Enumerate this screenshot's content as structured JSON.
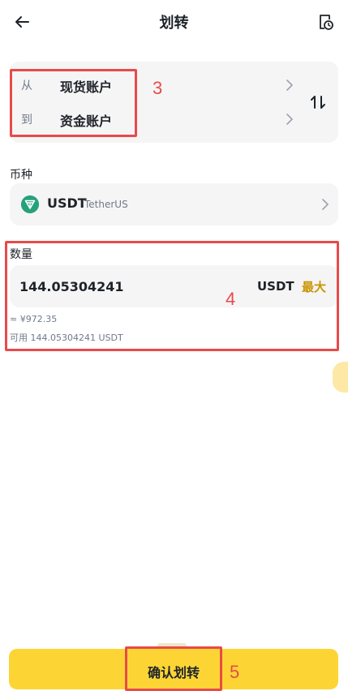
{
  "header": {
    "title": "划转"
  },
  "transfer": {
    "from_label": "从",
    "from_account": "现货账户",
    "to_label": "到",
    "to_account": "资金账户"
  },
  "coin": {
    "label": "币种",
    "symbol": "USDT",
    "name": "TetherUS"
  },
  "amount": {
    "label": "数量",
    "value": "144.05304241",
    "unit": "USDT",
    "max_label": "最大",
    "cny_estimate": "≈ ¥972.35",
    "available": "可用 144.05304241 USDT"
  },
  "confirm": {
    "label": "确认划转"
  },
  "annotations": [
    "3",
    "4",
    "5"
  ],
  "colors": {
    "accent": "#fcd535",
    "max": "#c99400",
    "annotation": "#e84a4a",
    "tether": "#26a17b"
  }
}
